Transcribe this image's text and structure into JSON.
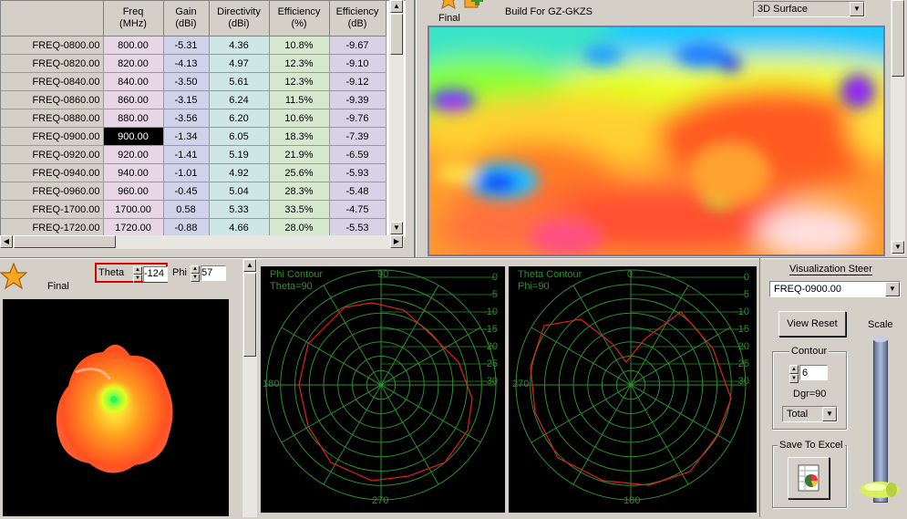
{
  "table": {
    "headers": [
      "Freq\n(MHz)",
      "Gain\n(dBi)",
      "Directivity\n(dBi)",
      "Efficiency\n(%)",
      "Efficiency\n(dB)"
    ],
    "rows": [
      {
        "name": "FREQ-0800.00",
        "freq": "800.00",
        "gain": "-5.31",
        "dir": "4.36",
        "eff_pct": "10.8%",
        "eff_db": "-9.67"
      },
      {
        "name": "FREQ-0820.00",
        "freq": "820.00",
        "gain": "-4.13",
        "dir": "4.97",
        "eff_pct": "12.3%",
        "eff_db": "-9.10"
      },
      {
        "name": "FREQ-0840.00",
        "freq": "840.00",
        "gain": "-3.50",
        "dir": "5.61",
        "eff_pct": "12.3%",
        "eff_db": "-9.12"
      },
      {
        "name": "FREQ-0860.00",
        "freq": "860.00",
        "gain": "-3.15",
        "dir": "6.24",
        "eff_pct": "11.5%",
        "eff_db": "-9.39"
      },
      {
        "name": "FREQ-0880.00",
        "freq": "880.00",
        "gain": "-3.56",
        "dir": "6.20",
        "eff_pct": "10.6%",
        "eff_db": "-9.76"
      },
      {
        "name": "FREQ-0900.00",
        "freq": "900.00",
        "gain": "-1.34",
        "dir": "6.05",
        "eff_pct": "18.3%",
        "eff_db": "-7.39"
      },
      {
        "name": "FREQ-0920.00",
        "freq": "920.00",
        "gain": "-1.41",
        "dir": "5.19",
        "eff_pct": "21.9%",
        "eff_db": "-6.59"
      },
      {
        "name": "FREQ-0940.00",
        "freq": "940.00",
        "gain": "-1.01",
        "dir": "4.92",
        "eff_pct": "25.6%",
        "eff_db": "-5.93"
      },
      {
        "name": "FREQ-0960.00",
        "freq": "960.00",
        "gain": "-0.45",
        "dir": "5.04",
        "eff_pct": "28.3%",
        "eff_db": "-5.48"
      },
      {
        "name": "FREQ-1700.00",
        "freq": "1700.00",
        "gain": "0.58",
        "dir": "5.33",
        "eff_pct": "33.5%",
        "eff_db": "-4.75"
      },
      {
        "name": "FREQ-1720.00",
        "freq": "1720.00",
        "gain": "-0.88",
        "dir": "4.66",
        "eff_pct": "28.0%",
        "eff_db": "-5.53"
      }
    ],
    "selected_row_index": 5
  },
  "surface_panel": {
    "final_label": "Final",
    "build_label": "Build For GZ-GKZS",
    "view_mode": "3D Surface"
  },
  "pattern3d": {
    "final_label": "Final",
    "theta_label": "Theta",
    "theta_value": "-124",
    "phi_label": "Phi",
    "phi_value": "57"
  },
  "phi_plot": {
    "title_line1": "Phi Contour",
    "title_line2": "Theta=90",
    "angle_top": "90",
    "angle_left": "180",
    "angle_bottom": "270",
    "scale": [
      "0",
      "-5",
      "-10",
      "-15",
      "-20",
      "-25",
      "-30"
    ]
  },
  "theta_plot": {
    "title_line1": "Theta Contour",
    "title_line2": "Phi=90",
    "angle_top": "0",
    "angle_left": "270",
    "angle_bottom": "180",
    "scale": [
      "0",
      "-5",
      "-10",
      "-15",
      "-20",
      "-25",
      "-30"
    ]
  },
  "controls": {
    "visualization_label": "Visualization Steer",
    "freq_selected": "FREQ-0900.00",
    "view_reset": "View Reset",
    "scale_label": "Scale",
    "contour_label": "Contour",
    "contour_value": "6",
    "dgr_label": "Dgr=90",
    "mode_selected": "Total",
    "save_excel": "Save To Excel"
  },
  "icons": {
    "star": "star-icon",
    "add": "add-icon",
    "excel": "excel-chart-icon"
  }
}
